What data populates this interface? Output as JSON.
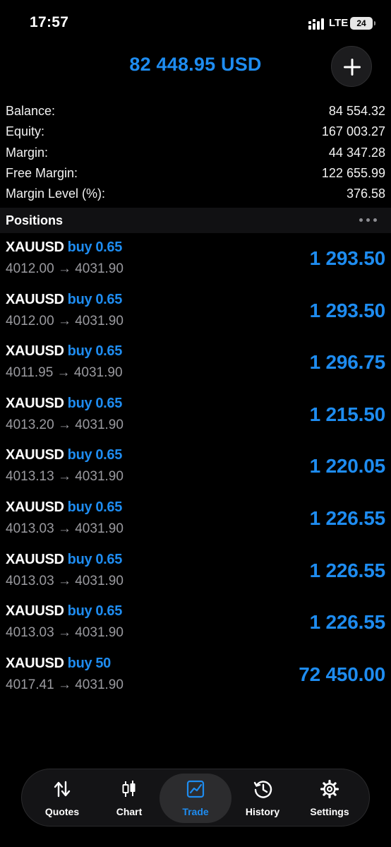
{
  "status_bar": {
    "time": "17:57",
    "network": "LTE",
    "battery": "24"
  },
  "header": {
    "equity_display": "82 448.95 USD",
    "add_icon": "plus-icon"
  },
  "summary": [
    {
      "label": "Balance:",
      "value": "84 554.32"
    },
    {
      "label": "Equity:",
      "value": "167 003.27"
    },
    {
      "label": "Margin:",
      "value": "44 347.28"
    },
    {
      "label": "Free Margin:",
      "value": "122 655.99"
    },
    {
      "label": "Margin Level (%):",
      "value": "376.58"
    }
  ],
  "positions": {
    "title": "Positions",
    "items": [
      {
        "symbol": "XAUUSD",
        "direction": "buy",
        "volume": "0.65",
        "prices": "4012.00 → 4031.90",
        "profit": "1 293.50"
      },
      {
        "symbol": "XAUUSD",
        "direction": "buy",
        "volume": "0.65",
        "prices": "4012.00 → 4031.90",
        "profit": "1 293.50"
      },
      {
        "symbol": "XAUUSD",
        "direction": "buy",
        "volume": "0.65",
        "prices": "4011.95 → 4031.90",
        "profit": "1 296.75"
      },
      {
        "symbol": "XAUUSD",
        "direction": "buy",
        "volume": "0.65",
        "prices": "4013.20 → 4031.90",
        "profit": "1 215.50"
      },
      {
        "symbol": "XAUUSD",
        "direction": "buy",
        "volume": "0.65",
        "prices": "4013.13 → 4031.90",
        "profit": "1 220.05"
      },
      {
        "symbol": "XAUUSD",
        "direction": "buy",
        "volume": "0.65",
        "prices": "4013.03 → 4031.90",
        "profit": "1 226.55"
      },
      {
        "symbol": "XAUUSD",
        "direction": "buy",
        "volume": "0.65",
        "prices": "4013.03 → 4031.90",
        "profit": "1 226.55"
      },
      {
        "symbol": "XAUUSD",
        "direction": "buy",
        "volume": "0.65",
        "prices": "4013.03 → 4031.90",
        "profit": "1 226.55"
      },
      {
        "symbol": "XAUUSD",
        "direction": "buy",
        "volume": "50",
        "prices": "4017.41 → 4031.90",
        "profit": "72 450.00"
      }
    ]
  },
  "tabs": [
    {
      "label": "Quotes",
      "icon": "quotes-arrows-icon",
      "active": false
    },
    {
      "label": "Chart",
      "icon": "candlestick-icon",
      "active": false
    },
    {
      "label": "Trade",
      "icon": "trade-chart-icon",
      "active": true
    },
    {
      "label": "History",
      "icon": "history-clock-icon",
      "active": false
    },
    {
      "label": "Settings",
      "icon": "gear-icon",
      "active": false
    }
  ],
  "colors": {
    "accent": "#1e8cf0",
    "background": "#000000",
    "secondary_text": "#9a9a9f"
  }
}
